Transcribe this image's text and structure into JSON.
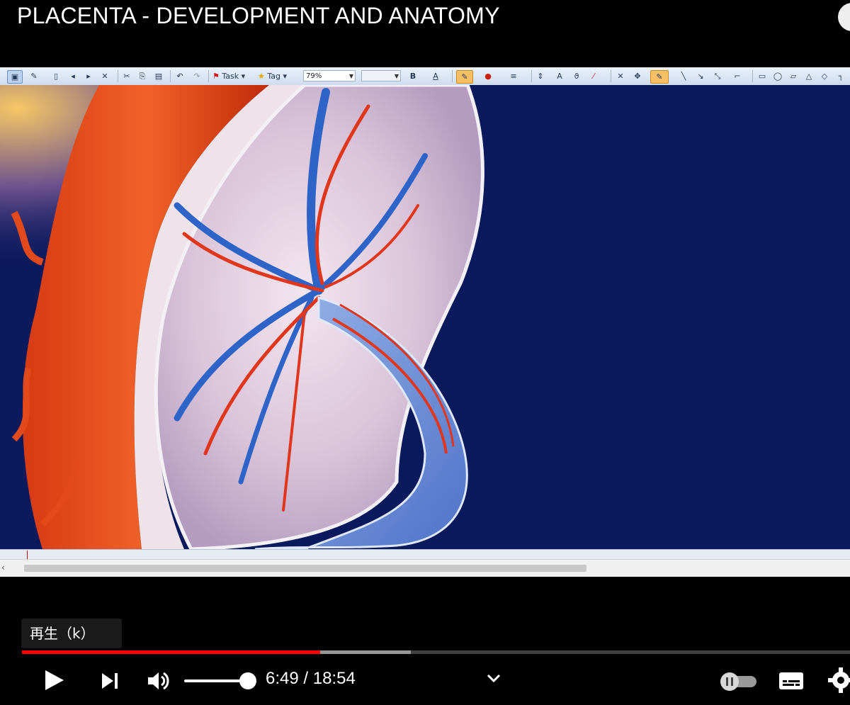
{
  "video": {
    "title": "PLACENTA - DEVELOPMENT AND ANATOMY"
  },
  "app": {
    "toolbar": {
      "task_label": "Task",
      "tag_label": "Tag",
      "zoom_value": "79%",
      "bold_label": "B",
      "underline_a_label": "A"
    }
  },
  "player": {
    "tooltip": "再生（k）",
    "current_time": "6:49",
    "time_separator": "/",
    "duration": "18:54",
    "progress_played": 0.36,
    "progress_buffered": 0.47,
    "volume_level": 0.87,
    "colors": {
      "progress_played": "#ff0000",
      "icon": "#ffffff"
    },
    "icons": {
      "play": "play-icon",
      "next": "next-icon",
      "volume": "volume-icon",
      "chevron": "chevron-down-icon",
      "autoplay": "autoplay-toggle-icon",
      "subtitles": "subtitles-icon",
      "settings": "gear-icon"
    }
  }
}
